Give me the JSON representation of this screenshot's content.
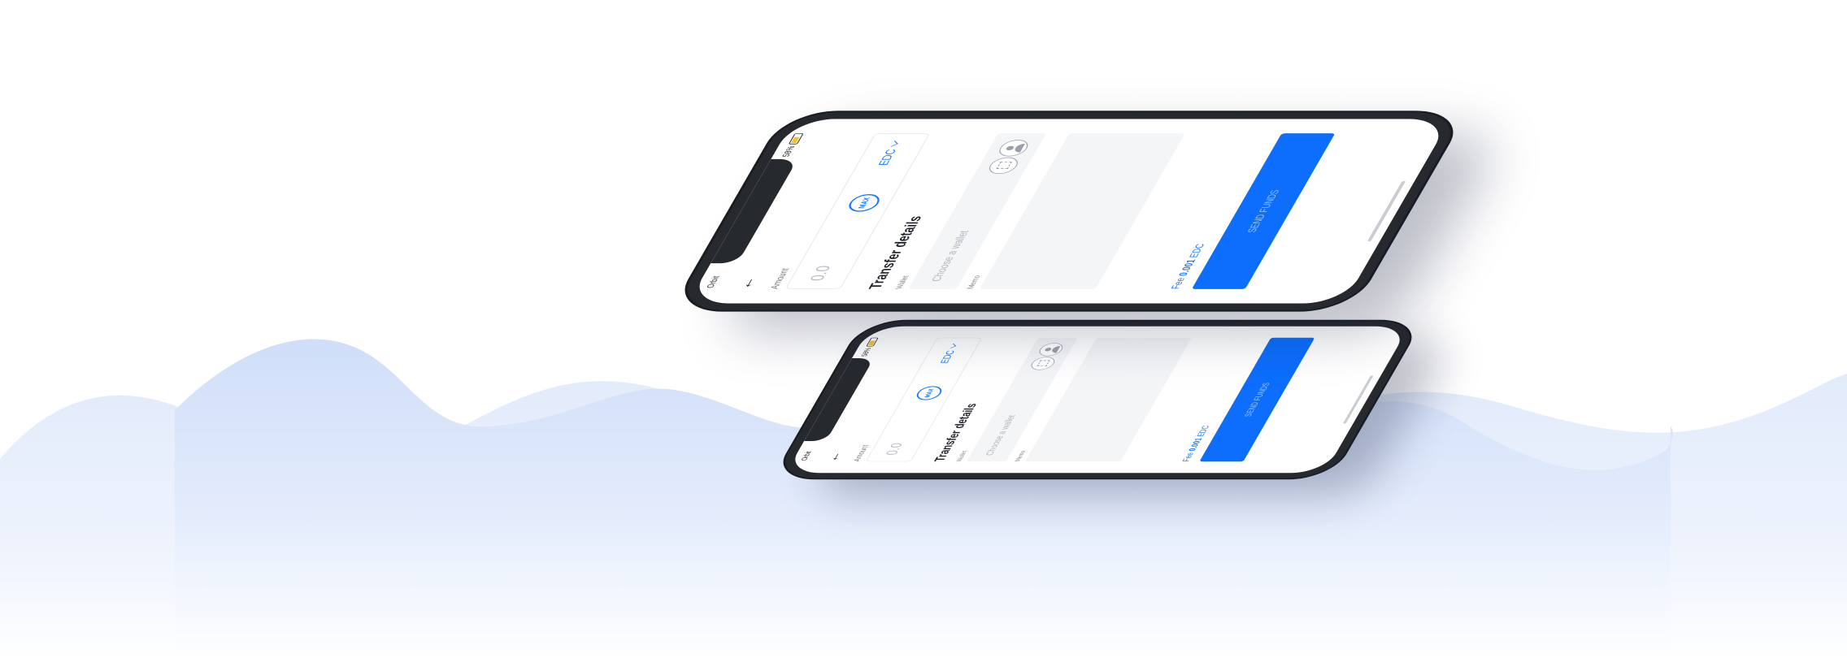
{
  "phones": [
    {
      "status": {
        "carrier": "Orbit",
        "battery": "58%"
      },
      "amount": {
        "label": "Amount",
        "placeholder": "0.0",
        "max_label": "MAX",
        "currency": "EDC"
      },
      "transfer": {
        "title": "Transfer details",
        "wallet_label": "Wallet",
        "wallet_placeholder": "Choose a wallet",
        "memo_label": "Memo"
      },
      "fee": {
        "prefix": "Fee",
        "value": "0.001",
        "currency": "EDC"
      },
      "send_label": "SEND FUNDS"
    },
    {
      "status": {
        "carrier": "Orbit",
        "battery": "58%"
      },
      "amount": {
        "label": "Amount",
        "placeholder": "0.0",
        "max_label": "MAX",
        "currency": "EDC"
      },
      "transfer": {
        "title": "Transfer details",
        "wallet_label": "Wallet",
        "wallet_placeholder": "Choose a wallet",
        "memo_label": "Memo"
      },
      "fee": {
        "prefix": "Fee",
        "value": "0.001",
        "currency": "EDC"
      },
      "send_label": "SEND FUNDS"
    }
  ],
  "colors": {
    "accent": "#0d6efd",
    "wave_light": "#e6eefb",
    "wave_mid": "#d3e1f9",
    "phone_body": "#26292e"
  }
}
